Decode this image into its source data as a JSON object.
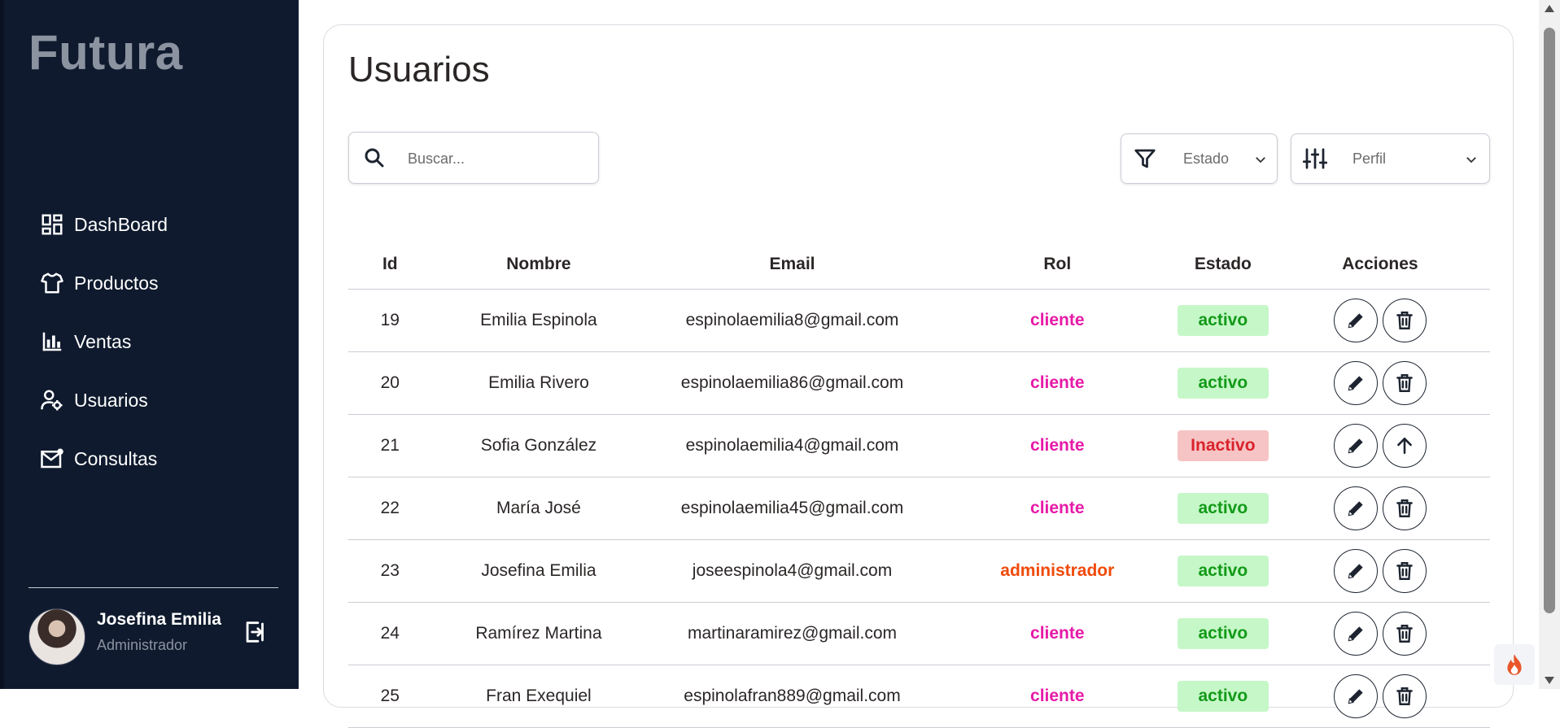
{
  "app": {
    "brand": "Futura"
  },
  "sidebar": {
    "items": [
      {
        "label": "DashBoard",
        "icon": "dashboard-icon"
      },
      {
        "label": "Productos",
        "icon": "shirt-icon"
      },
      {
        "label": "Ventas",
        "icon": "bar-chart-icon"
      },
      {
        "label": "Usuarios",
        "icon": "users-icon"
      },
      {
        "label": "Consultas",
        "icon": "mail-icon"
      }
    ],
    "user": {
      "name": "Josefina Emilia",
      "role": "Administrador"
    }
  },
  "main": {
    "title": "Usuarios",
    "search": {
      "placeholder": "Buscar...",
      "value": ""
    },
    "filters": {
      "estado": {
        "label": "Estado",
        "icon": "filter-icon"
      },
      "perfil": {
        "label": "Perfil",
        "icon": "sliders-icon"
      }
    },
    "table": {
      "columns": [
        "Id",
        "Nombre",
        "Email",
        "Rol",
        "Estado",
        "Acciones"
      ],
      "rows": [
        {
          "id": "19",
          "nombre": "Emilia Espinola",
          "email": "espinolaemilia8@gmail.com",
          "rol": "cliente",
          "estado": "activo",
          "second_action": "delete"
        },
        {
          "id": "20",
          "nombre": "Emilia Rivero",
          "email": "espinolaemilia86@gmail.com",
          "rol": "cliente",
          "estado": "activo",
          "second_action": "delete"
        },
        {
          "id": "21",
          "nombre": "Sofia González",
          "email": "espinolaemilia4@gmail.com",
          "rol": "cliente",
          "estado": "Inactivo",
          "second_action": "restore"
        },
        {
          "id": "22",
          "nombre": "María José",
          "email": "espinolaemilia45@gmail.com",
          "rol": "cliente",
          "estado": "activo",
          "second_action": "delete"
        },
        {
          "id": "23",
          "nombre": "Josefina Emilia",
          "email": "joseespinola4@gmail.com",
          "rol": "administrador",
          "estado": "activo",
          "second_action": "delete"
        },
        {
          "id": "24",
          "nombre": "Ramírez Martina",
          "email": "martinaramirez@gmail.com",
          "rol": "cliente",
          "estado": "activo",
          "second_action": "delete"
        },
        {
          "id": "25",
          "nombre": "Fran Exequiel",
          "email": "espinolafran889@gmail.com",
          "rol": "cliente",
          "estado": "activo",
          "second_action": "delete"
        }
      ]
    }
  },
  "colors": {
    "sidebar_bg": "#0f1a2e",
    "role_cliente": "#e61aa8",
    "role_administrador": "#f04a0a",
    "active_bg": "#c6f7c8",
    "active_text": "#129a18",
    "inactive_bg": "#f6c4c4",
    "inactive_text": "#d9232c"
  }
}
